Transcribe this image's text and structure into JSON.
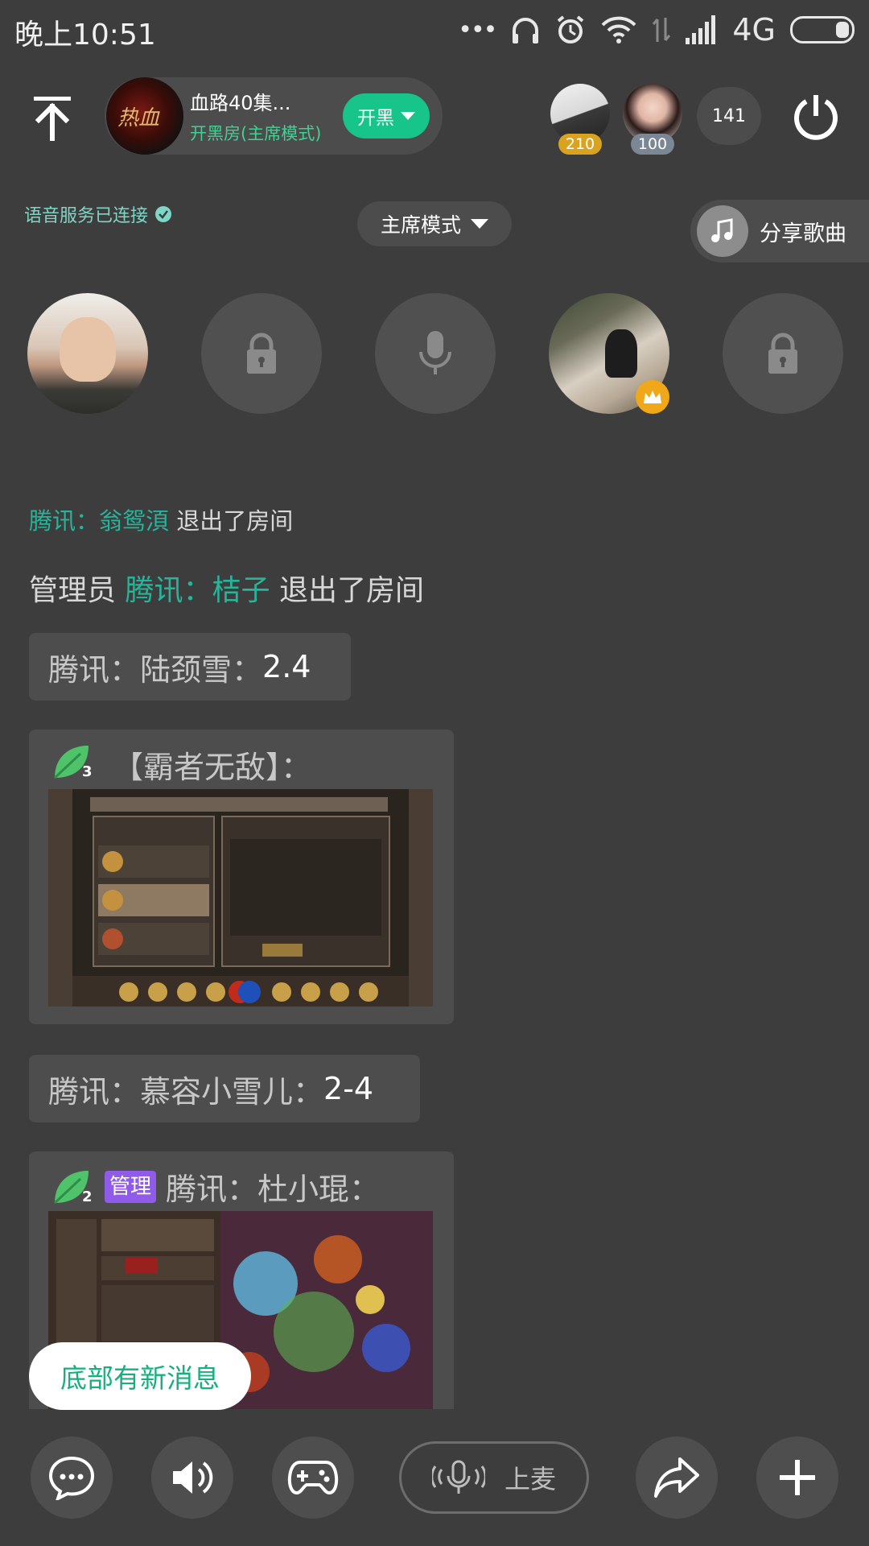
{
  "status_bar": {
    "time": "晚上10:51",
    "network": "4G"
  },
  "header": {
    "room_name": "血路40集...",
    "room_mode": "开黑房(主席模式)",
    "kaihei_label": "开黑",
    "top_users": [
      {
        "badge": "210",
        "badge_color": "#d9a320"
      },
      {
        "badge": "100",
        "badge_color": "#7b8794"
      }
    ],
    "online_count": "141"
  },
  "sub_header": {
    "voice_status": "语音服务已连接",
    "mode_dropdown": "主席模式",
    "share_song": "分享歌曲"
  },
  "chat": {
    "sys1": {
      "prefix": "腾讯：翁鸳湏",
      "suffix": "退出了房间"
    },
    "sys2": {
      "role": "管理员",
      "name": "腾讯：桔子",
      "suffix": "退出了房间"
    },
    "msg1": {
      "sender": "腾讯：陆颈雪：",
      "text": "2.4"
    },
    "msg2": {
      "level": "3",
      "sender": "【霸者无敌】："
    },
    "msg3": {
      "sender": "腾讯：慕容小雪儿：",
      "text": "2-4"
    },
    "msg4": {
      "level": "2",
      "tag": "管理",
      "sender": "腾讯：杜小琨："
    }
  },
  "new_message_toast": "底部有新消息",
  "bottom_bar": {
    "mic_label": "上麦"
  },
  "colors": {
    "accent_green": "#17c48a",
    "teal_name": "#26b59a",
    "admin_tag": "#8f5be8"
  }
}
